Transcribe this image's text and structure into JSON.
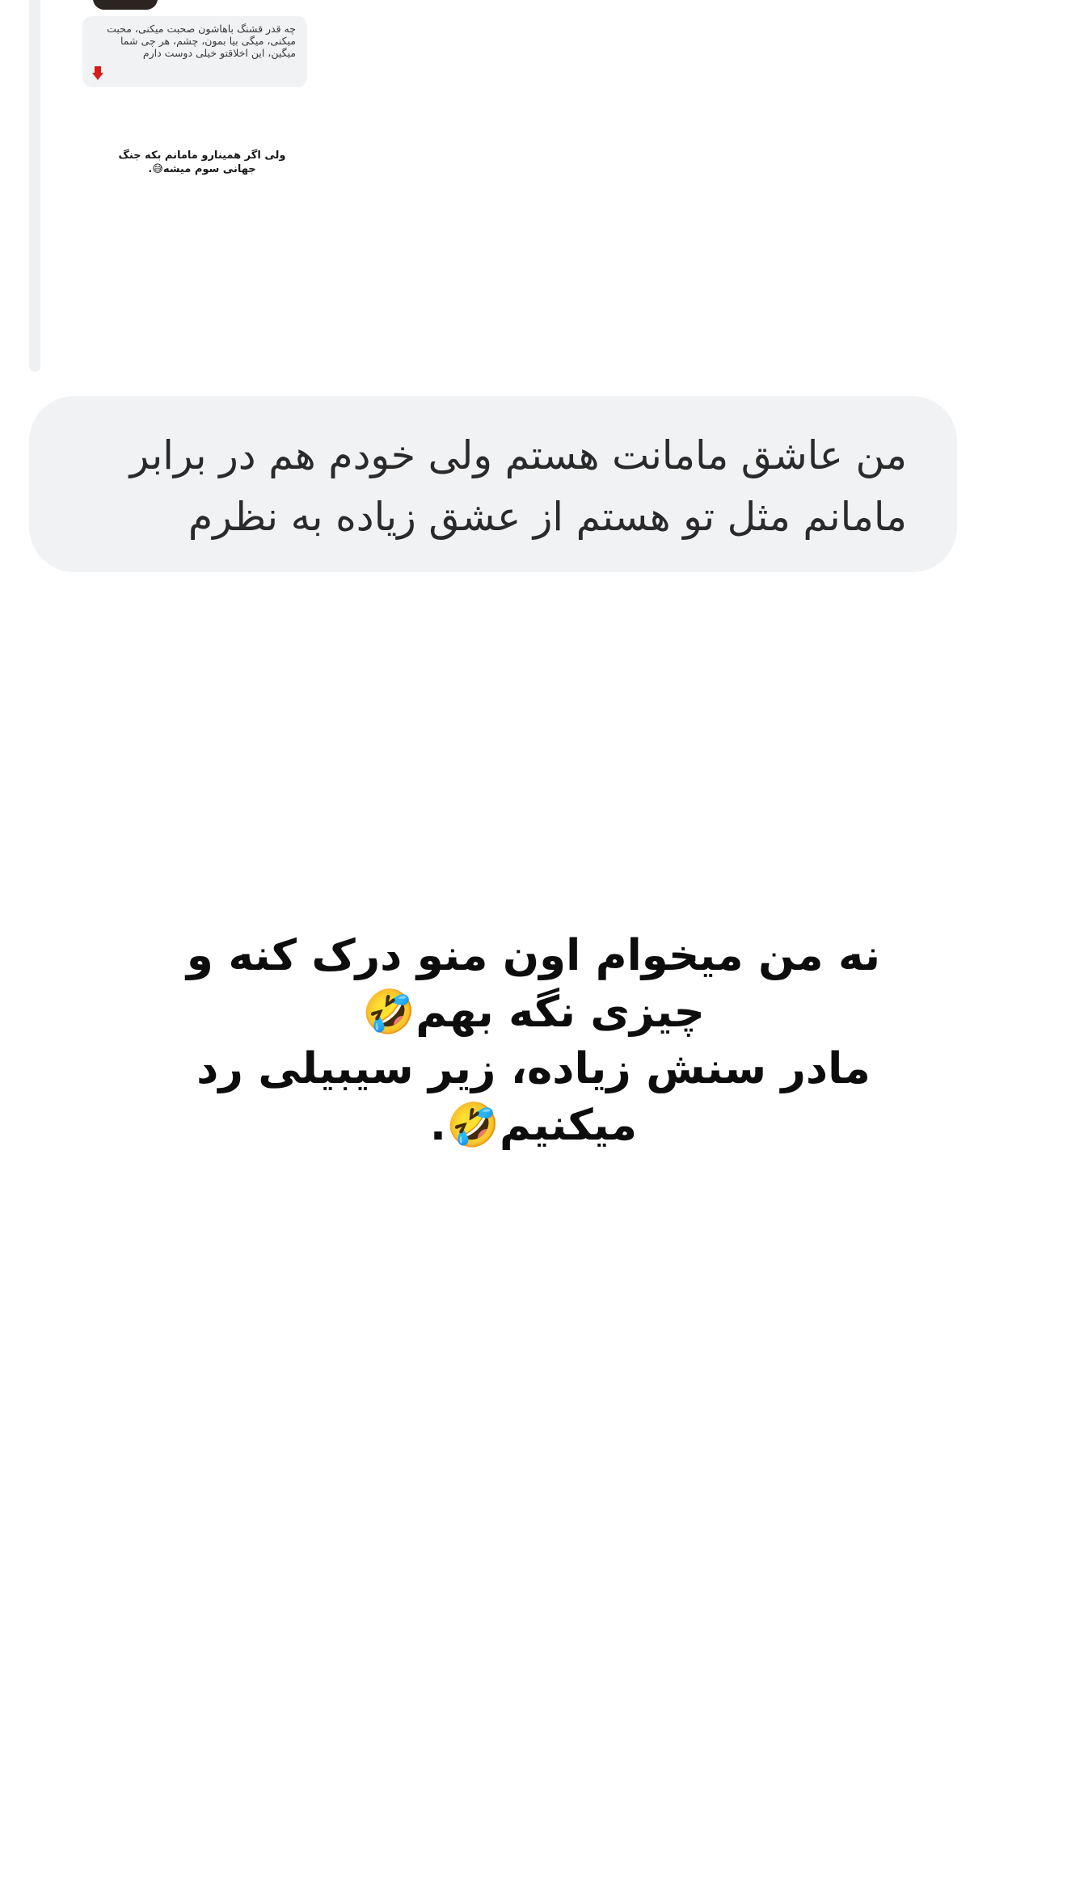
{
  "reply_thread": {
    "quoted_comment": {
      "text": "چه قدر قشنگ باهاشون صحبت میکنی، محبت میکنی، میگی بیا بمون، چشم، هر چی شما میگین، این اخلاقتو خیلی دوست دارم",
      "reaction_icon": "red-down-arrow-icon"
    },
    "small_caption": "ولی اگر همینارو مامانم بکه جنگ\nجهانی سوم میشه😅."
  },
  "message": {
    "text": "من عاشق مامانت هستم ولی خودم هم در برابر\nمامانم مثل تو هستم از عشق زیاده به نظرم"
  },
  "story_caption": {
    "text": "نه من میخوام اون منو درک کنه و\nچیزی نگه بهم🤣\nمادر سنش زیاده، زیر سیبیلی رد\nمیکنیم🤣."
  },
  "colors": {
    "bubble_background": "#f1f2f4",
    "thread_line": "#eef0f2",
    "reaction_red": "#d81b1b"
  }
}
